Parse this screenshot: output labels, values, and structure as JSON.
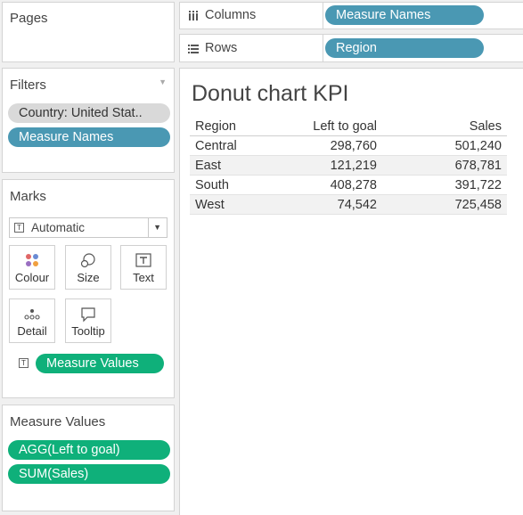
{
  "pages": {
    "title": "Pages"
  },
  "columns_shelf": {
    "label": "Columns",
    "pill": "Measure Names"
  },
  "rows_shelf": {
    "label": "Rows",
    "pill": "Region"
  },
  "filters": {
    "title": "Filters",
    "items": [
      "Country: United Stat..",
      "Measure Names"
    ]
  },
  "marks": {
    "title": "Marks",
    "mark_type": "Automatic",
    "cards": [
      "Colour",
      "Size",
      "Text",
      "Detail",
      "Tooltip"
    ],
    "field_pill": "Measure Values"
  },
  "measure_values": {
    "title": "Measure Values",
    "items": [
      "AGG(Left to goal)",
      "SUM(Sales)"
    ]
  },
  "view": {
    "title": "Donut chart KPI",
    "headers": [
      "Region",
      "Left to goal",
      "Sales"
    ],
    "rows": [
      [
        "Central",
        "298,760",
        "501,240"
      ],
      [
        "East",
        "121,219",
        "678,781"
      ],
      [
        "South",
        "408,278",
        "391,722"
      ],
      [
        "West",
        "74,542",
        "725,458"
      ]
    ]
  },
  "colors": {
    "dimension_pill": "#4a98b3",
    "measure_pill": "#0fb07a",
    "filter_pill": "#d9d9d9"
  }
}
